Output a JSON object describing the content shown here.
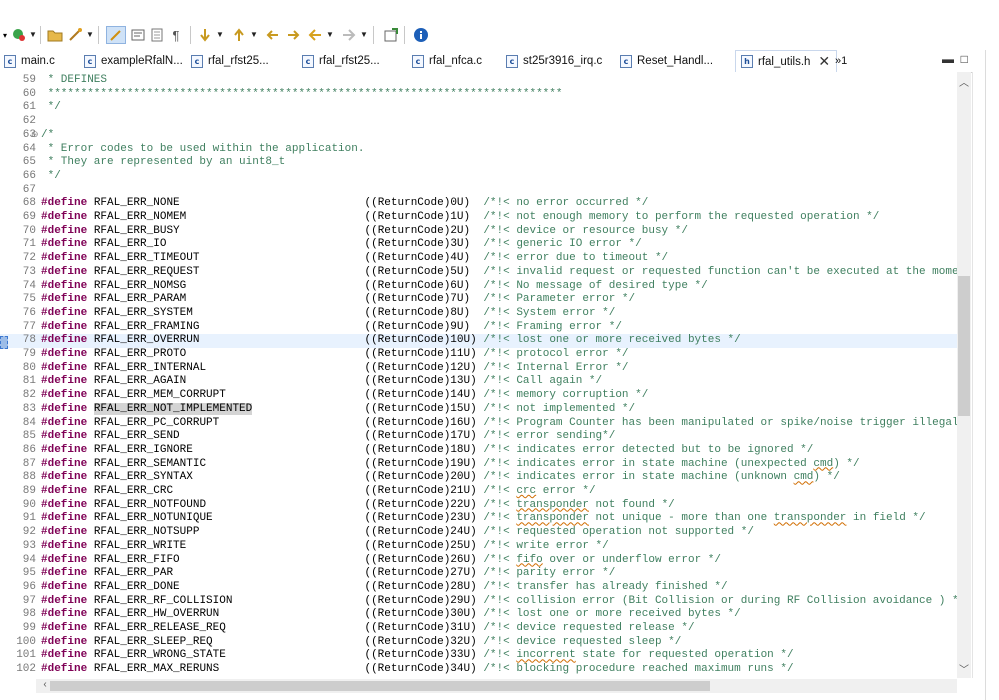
{
  "toolbar": {
    "overflow_label": "»1"
  },
  "tabs": [
    {
      "label": "main.c",
      "icon": "c-file-icon"
    },
    {
      "label": "exampleRfalN...",
      "icon": "c-file-icon"
    },
    {
      "label": "rfal_rfst25...",
      "icon": "c-file-icon"
    },
    {
      "label": "rfal_rfst25...",
      "icon": "c-file-icon"
    },
    {
      "label": "rfal_nfca.c",
      "icon": "c-file-icon"
    },
    {
      "label": "st25r3916_irq.c",
      "icon": "c-file-icon"
    },
    {
      "label": "Reset_Handl...",
      "icon": "c-file-icon"
    },
    {
      "label": "rfal_utils.h",
      "icon": "h-file-icon",
      "active": true
    }
  ],
  "editor": {
    "lines": [
      {
        "num": "59",
        "kind": "comment",
        "text": " * DEFINES"
      },
      {
        "num": "60",
        "kind": "comment",
        "text": " ******************************************************************************"
      },
      {
        "num": "61",
        "kind": "comment",
        "text": " */"
      },
      {
        "num": "62",
        "kind": "blank",
        "text": ""
      },
      {
        "num": "63",
        "kind": "comment",
        "text": "/*",
        "fold": "⊖"
      },
      {
        "num": "64",
        "kind": "comment",
        "text": " * Error codes to be used within the application."
      },
      {
        "num": "65",
        "kind": "comment",
        "text": " * They are represented by an uint8_t"
      },
      {
        "num": "66",
        "kind": "comment",
        "text": " */"
      },
      {
        "num": "67",
        "kind": "blank",
        "text": ""
      },
      {
        "num": "68",
        "kind": "define",
        "name": "RFAL_ERR_NONE",
        "value": "((ReturnCode)0U)",
        "comment": "/*!< no error occurred */"
      },
      {
        "num": "69",
        "kind": "define",
        "name": "RFAL_ERR_NOMEM",
        "value": "((ReturnCode)1U)",
        "comment": "/*!< not enough memory to perform the requested operation */"
      },
      {
        "num": "70",
        "kind": "define",
        "name": "RFAL_ERR_BUSY",
        "value": "((ReturnCode)2U)",
        "comment": "/*!< device or resource busy */"
      },
      {
        "num": "71",
        "kind": "define",
        "name": "RFAL_ERR_IO",
        "value": "((ReturnCode)3U)",
        "comment": "/*!< generic IO error */"
      },
      {
        "num": "72",
        "kind": "define",
        "name": "RFAL_ERR_TIMEOUT",
        "value": "((ReturnCode)4U)",
        "comment": "/*!< error due to timeout */"
      },
      {
        "num": "73",
        "kind": "define",
        "name": "RFAL_ERR_REQUEST",
        "value": "((ReturnCode)5U)",
        "comment": "/*!< invalid request or requested function can't be executed at the moment */"
      },
      {
        "num": "74",
        "kind": "define",
        "name": "RFAL_ERR_NOMSG",
        "value": "((ReturnCode)6U)",
        "comment": "/*!< No message of desired type */"
      },
      {
        "num": "75",
        "kind": "define",
        "name": "RFAL_ERR_PARAM",
        "value": "((ReturnCode)7U)",
        "comment": "/*!< Parameter error */"
      },
      {
        "num": "76",
        "kind": "define",
        "name": "RFAL_ERR_SYSTEM",
        "value": "((ReturnCode)8U)",
        "comment": "/*!< System error */"
      },
      {
        "num": "77",
        "kind": "define",
        "name": "RFAL_ERR_FRAMING",
        "value": "((ReturnCode)9U)",
        "comment": "/*!< Framing error */"
      },
      {
        "num": "78",
        "kind": "define",
        "name": "RFAL_ERR_OVERRUN",
        "value": "((ReturnCode)10U)",
        "comment": "/*!< lost one or more received bytes */",
        "highlight": true
      },
      {
        "num": "79",
        "kind": "define",
        "name": "RFAL_ERR_PROTO",
        "value": "((ReturnCode)11U)",
        "comment": "/*!< protocol error */"
      },
      {
        "num": "80",
        "kind": "define",
        "name": "RFAL_ERR_INTERNAL",
        "value": "((ReturnCode)12U)",
        "comment": "/*!< Internal Error */"
      },
      {
        "num": "81",
        "kind": "define",
        "name": "RFAL_ERR_AGAIN",
        "value": "((ReturnCode)13U)",
        "comment": "/*!< Call again */"
      },
      {
        "num": "82",
        "kind": "define",
        "name": "RFAL_ERR_MEM_CORRUPT",
        "value": "((ReturnCode)14U)",
        "comment": "/*!< memory corruption */"
      },
      {
        "num": "83",
        "kind": "define",
        "name": "RFAL_ERR_NOT_IMPLEMENTED",
        "value": "((ReturnCode)15U)",
        "comment": "/*!< not implemented */",
        "selected": true
      },
      {
        "num": "84",
        "kind": "define",
        "name": "RFAL_ERR_PC_CORRUPT",
        "value": "((ReturnCode)16U)",
        "comment": "/*!< Program Counter has been manipulated or spike/noise trigger illegal operation */"
      },
      {
        "num": "85",
        "kind": "define",
        "name": "RFAL_ERR_SEND",
        "value": "((ReturnCode)17U)",
        "comment": "/*!< error sending*/"
      },
      {
        "num": "86",
        "kind": "define",
        "name": "RFAL_ERR_IGNORE",
        "value": "((ReturnCode)18U)",
        "comment": "/*!< indicates error detected but to be ignored */"
      },
      {
        "num": "87",
        "kind": "define",
        "name": "RFAL_ERR_SEMANTIC",
        "value": "((ReturnCode)19U)",
        "comment": "/*!< indicates error in state machine (unexpected cmd) */"
      },
      {
        "num": "88",
        "kind": "define",
        "name": "RFAL_ERR_SYNTAX",
        "value": "((ReturnCode)20U)",
        "comment": "/*!< indicates error in state machine (unknown cmd) */"
      },
      {
        "num": "89",
        "kind": "define",
        "name": "RFAL_ERR_CRC",
        "value": "((ReturnCode)21U)",
        "comment": "/*!< crc error */"
      },
      {
        "num": "90",
        "kind": "define",
        "name": "RFAL_ERR_NOTFOUND",
        "value": "((ReturnCode)22U)",
        "comment": "/*!< transponder not found */"
      },
      {
        "num": "91",
        "kind": "define",
        "name": "RFAL_ERR_NOTUNIQUE",
        "value": "((ReturnCode)23U)",
        "comment": "/*!< transponder not unique - more than one transponder in field */"
      },
      {
        "num": "92",
        "kind": "define",
        "name": "RFAL_ERR_NOTSUPP",
        "value": "((ReturnCode)24U)",
        "comment": "/*!< requested operation not supported */"
      },
      {
        "num": "93",
        "kind": "define",
        "name": "RFAL_ERR_WRITE",
        "value": "((ReturnCode)25U)",
        "comment": "/*!< write error */"
      },
      {
        "num": "94",
        "kind": "define",
        "name": "RFAL_ERR_FIFO",
        "value": "((ReturnCode)26U)",
        "comment": "/*!< fifo over or underflow error */"
      },
      {
        "num": "95",
        "kind": "define",
        "name": "RFAL_ERR_PAR",
        "value": "((ReturnCode)27U)",
        "comment": "/*!< parity error */"
      },
      {
        "num": "96",
        "kind": "define",
        "name": "RFAL_ERR_DONE",
        "value": "((ReturnCode)28U)",
        "comment": "/*!< transfer has already finished */"
      },
      {
        "num": "97",
        "kind": "define",
        "name": "RFAL_ERR_RF_COLLISION",
        "value": "((ReturnCode)29U)",
        "comment": "/*!< collision error (Bit Collision or during RF Collision avoidance ) */"
      },
      {
        "num": "98",
        "kind": "define",
        "name": "RFAL_ERR_HW_OVERRUN",
        "value": "((ReturnCode)30U)",
        "comment": "/*!< lost one or more received bytes */"
      },
      {
        "num": "99",
        "kind": "define",
        "name": "RFAL_ERR_RELEASE_REQ",
        "value": "((ReturnCode)31U)",
        "comment": "/*!< device requested release */"
      },
      {
        "num": "100",
        "kind": "define",
        "name": "RFAL_ERR_SLEEP_REQ",
        "value": "((ReturnCode)32U)",
        "comment": "/*!< device requested sleep */"
      },
      {
        "num": "101",
        "kind": "define",
        "name": "RFAL_ERR_WRONG_STATE",
        "value": "((ReturnCode)33U)",
        "comment": "/*!< incorrent state for requested operation */"
      },
      {
        "num": "102",
        "kind": "define",
        "name": "RFAL_ERR_MAX_RERUNS",
        "value": "((ReturnCode)34U)",
        "comment": "/*!< blocking procedure reached maximum runs */"
      }
    ],
    "keyword": "#define",
    "squiggle_words": [
      "crc",
      "transponder",
      "fifo",
      "incorrent",
      "cmd"
    ]
  },
  "colors": {
    "keyword": "#7f0055",
    "comment": "#3f7f5f",
    "line_highlight": "#e8f2fe",
    "selection": "#d4d4d4"
  }
}
